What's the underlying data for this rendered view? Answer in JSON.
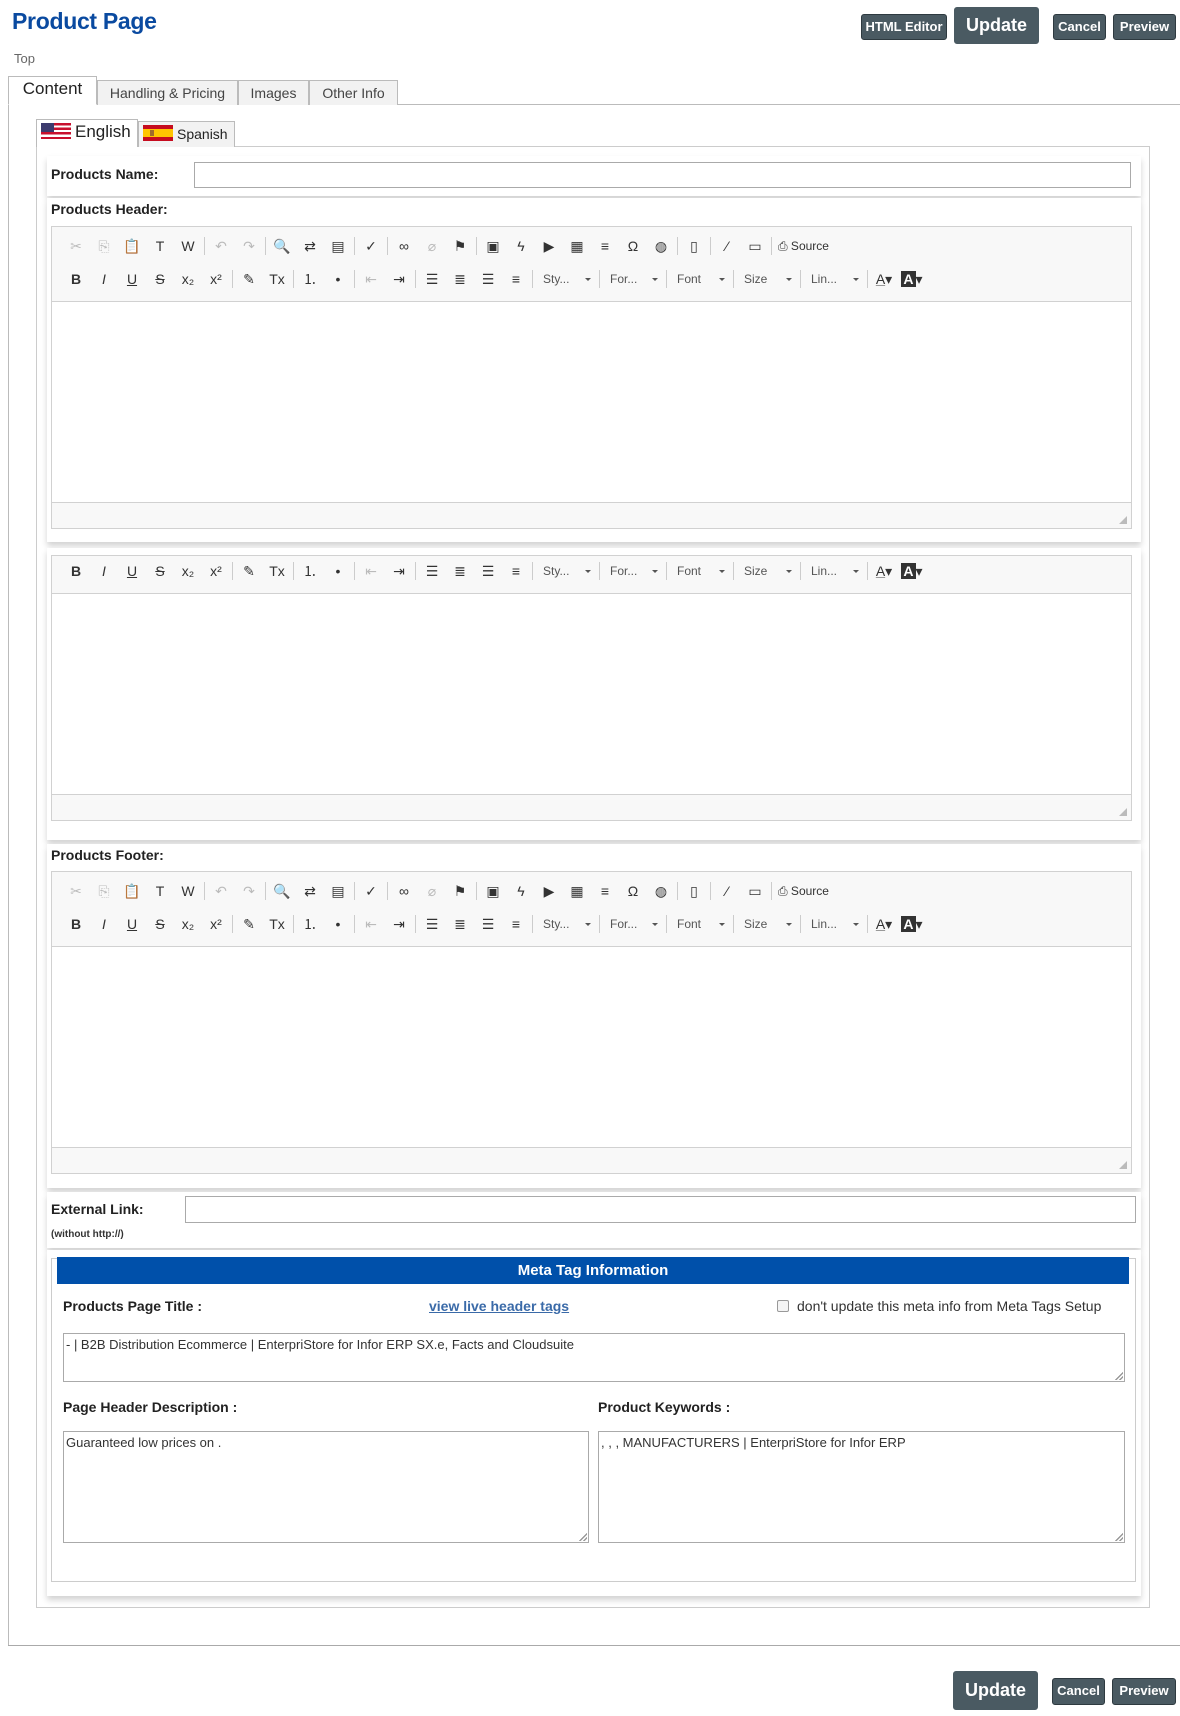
{
  "header": {
    "title": "Product Page",
    "breadcrumb": "Top",
    "buttons": {
      "html_editor": "HTML Editor",
      "update": "Update",
      "cancel": "Cancel",
      "preview": "Preview"
    }
  },
  "tabs": [
    {
      "label": "Content",
      "active": true
    },
    {
      "label": "Handling & Pricing",
      "active": false
    },
    {
      "label": "Images",
      "active": false
    },
    {
      "label": "Other Info",
      "active": false
    }
  ],
  "languages": [
    {
      "label": "English",
      "flag": "us-flag",
      "active": true
    },
    {
      "label": "Spanish",
      "flag": "es-flag",
      "active": false
    }
  ],
  "form": {
    "products_name": {
      "label": "Products Name:",
      "value": ""
    },
    "products_header": {
      "label": "Products Header:"
    },
    "products_footer": {
      "label": "Products Footer:"
    },
    "external_link": {
      "label": "External Link:",
      "hint": "(without http://)",
      "value": ""
    }
  },
  "editor_toolbar": {
    "row1": [
      "cut-icon",
      "copy-icon",
      "paste-icon",
      "paste-text-icon",
      "paste-word-icon",
      "|",
      "undo-icon",
      "redo-icon",
      "|",
      "find-icon",
      "replace-icon",
      "select-all-icon",
      "|",
      "spellcheck-icon",
      "|",
      "link-icon",
      "unlink-icon",
      "anchor-icon",
      "|",
      "image-icon",
      "flash-icon",
      "youtube-icon",
      "table-icon",
      "horizontal-rule-icon",
      "special-char-icon",
      "iframe-icon",
      "|",
      "page-break-icon",
      "|",
      "div-container-icon",
      "show-blocks-icon",
      "|"
    ],
    "source_label": "Source",
    "row2": [
      "bold-icon",
      "italic-icon",
      "underline-icon",
      "strikethrough-icon",
      "subscript-icon",
      "superscript-icon",
      "|",
      "copy-format-icon",
      "remove-format-icon",
      "|",
      "numbered-list-icon",
      "bulleted-list-icon",
      "|",
      "outdent-icon",
      "indent-icon",
      "|",
      "align-left-icon",
      "align-center-icon",
      "align-right-icon",
      "justify-icon",
      "|"
    ],
    "combos": [
      "Sty...",
      "For...",
      "Font",
      "Size",
      "Lin..."
    ]
  },
  "meta": {
    "section_title": "Meta Tag Information",
    "page_title_label": "Products Page Title :",
    "view_live_link": "view live header tags",
    "dont_update_label": "don't update this meta info from Meta Tags Setup",
    "dont_update_checked": false,
    "page_title_value": "-  | B2B Distribution Ecommerce | EnterpriStore for Infor ERP SX.e, Facts and Cloudsuite",
    "description_label": "Page Header Description :",
    "description_value": "Guaranteed low prices on .",
    "keywords_label": "Product Keywords :",
    "keywords_value": ", , , MANUFACTURERS | EnterpriStore for Infor ERP"
  }
}
